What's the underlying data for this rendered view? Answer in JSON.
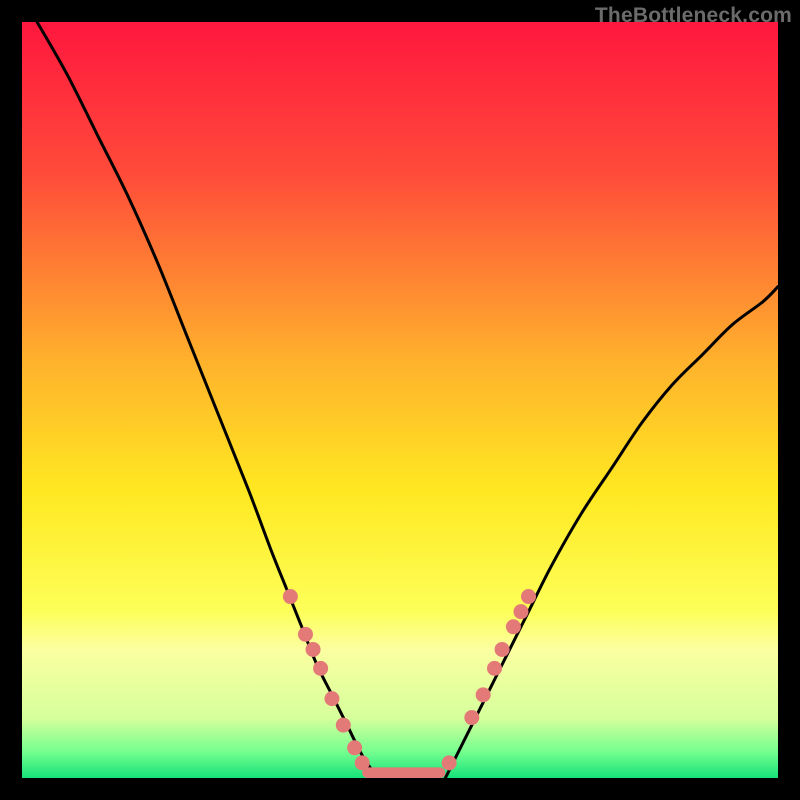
{
  "watermark": "TheBottleneck.com",
  "chart_data": {
    "type": "line",
    "title": "",
    "xlabel": "",
    "ylabel": "",
    "xlim": [
      0,
      100
    ],
    "ylim": [
      0,
      100
    ],
    "grid": false,
    "legend": false,
    "series": [
      {
        "name": "left-curve",
        "x": [
          2,
          6,
          10,
          14,
          18,
          22,
          26,
          30,
          33,
          35,
          37,
          39,
          41,
          43,
          45,
          47
        ],
        "y": [
          100,
          93,
          85,
          77,
          68,
          58,
          48,
          38,
          30,
          25,
          20,
          15,
          11,
          7,
          3,
          0
        ]
      },
      {
        "name": "right-curve",
        "x": [
          56,
          58,
          60,
          62,
          64,
          67,
          70,
          74,
          78,
          82,
          86,
          90,
          94,
          98,
          100
        ],
        "y": [
          0,
          4,
          8,
          12,
          16,
          22,
          28,
          35,
          41,
          47,
          52,
          56,
          60,
          63,
          65
        ]
      }
    ],
    "markers": [
      {
        "name": "left-dots",
        "x": [
          35.5,
          37.5,
          38.5,
          39.5,
          41.0,
          42.5,
          44.0,
          45.0
        ],
        "y": [
          24,
          19,
          17,
          14.5,
          10.5,
          7,
          4,
          2
        ]
      },
      {
        "name": "right-dots",
        "x": [
          56.5,
          59.5,
          61.0,
          62.5,
          63.5,
          65.0,
          66.0,
          67.0
        ],
        "y": [
          2,
          8,
          11,
          14.5,
          17,
          20,
          22,
          24
        ]
      }
    ],
    "bottom_bar": {
      "x0": 45,
      "x1": 56,
      "y": 0.7,
      "height": 1.4
    },
    "background_gradient": {
      "stops": [
        {
          "offset": 0.0,
          "color": "#ff173e"
        },
        {
          "offset": 0.2,
          "color": "#ff4b3a"
        },
        {
          "offset": 0.45,
          "color": "#ffb22c"
        },
        {
          "offset": 0.62,
          "color": "#ffe821"
        },
        {
          "offset": 0.78,
          "color": "#fdff59"
        },
        {
          "offset": 0.83,
          "color": "#fbffa0"
        },
        {
          "offset": 0.92,
          "color": "#d6ff9c"
        },
        {
          "offset": 0.965,
          "color": "#76ff8f"
        },
        {
          "offset": 1.0,
          "color": "#15e27a"
        }
      ]
    },
    "marker_color": "#e47a78",
    "curve_color": "#000000"
  }
}
